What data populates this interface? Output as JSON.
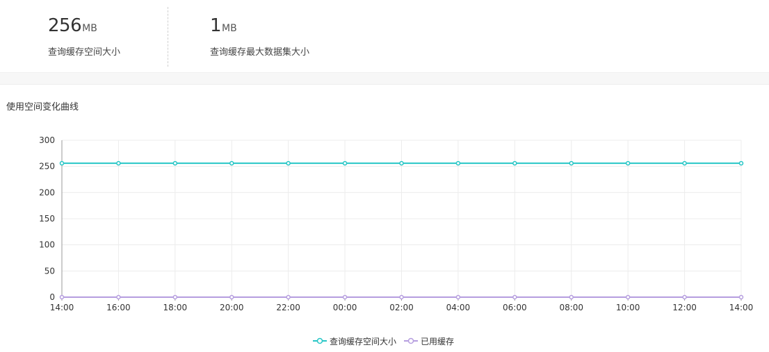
{
  "stats": [
    {
      "value": "256",
      "unit": "MB",
      "label": "查询缓存空间大小"
    },
    {
      "value": "1",
      "unit": "MB",
      "label": "查询缓存最大数据集大小"
    }
  ],
  "chart_title": "使用空间变化曲线",
  "chart_data": {
    "type": "line",
    "title": "使用空间变化曲线",
    "xlabel": "",
    "ylabel": "",
    "x": [
      "14:00",
      "16:00",
      "18:00",
      "20:00",
      "22:00",
      "00:00",
      "02:00",
      "04:00",
      "06:00",
      "08:00",
      "10:00",
      "12:00",
      "14:00"
    ],
    "ylim": [
      0,
      300
    ],
    "yticks": [
      0,
      50,
      100,
      150,
      200,
      250,
      300
    ],
    "grid": true,
    "legend_position": "bottom-center",
    "series": [
      {
        "name": "查询缓存空间大小",
        "color": "#26c6c6",
        "values": [
          256,
          256,
          256,
          256,
          256,
          256,
          256,
          256,
          256,
          256,
          256,
          256,
          256
        ]
      },
      {
        "name": "已用缓存",
        "color": "#b59ddf",
        "values": [
          0,
          0,
          0,
          0,
          0,
          0,
          0,
          0,
          0,
          0,
          0,
          0,
          0
        ]
      }
    ]
  }
}
